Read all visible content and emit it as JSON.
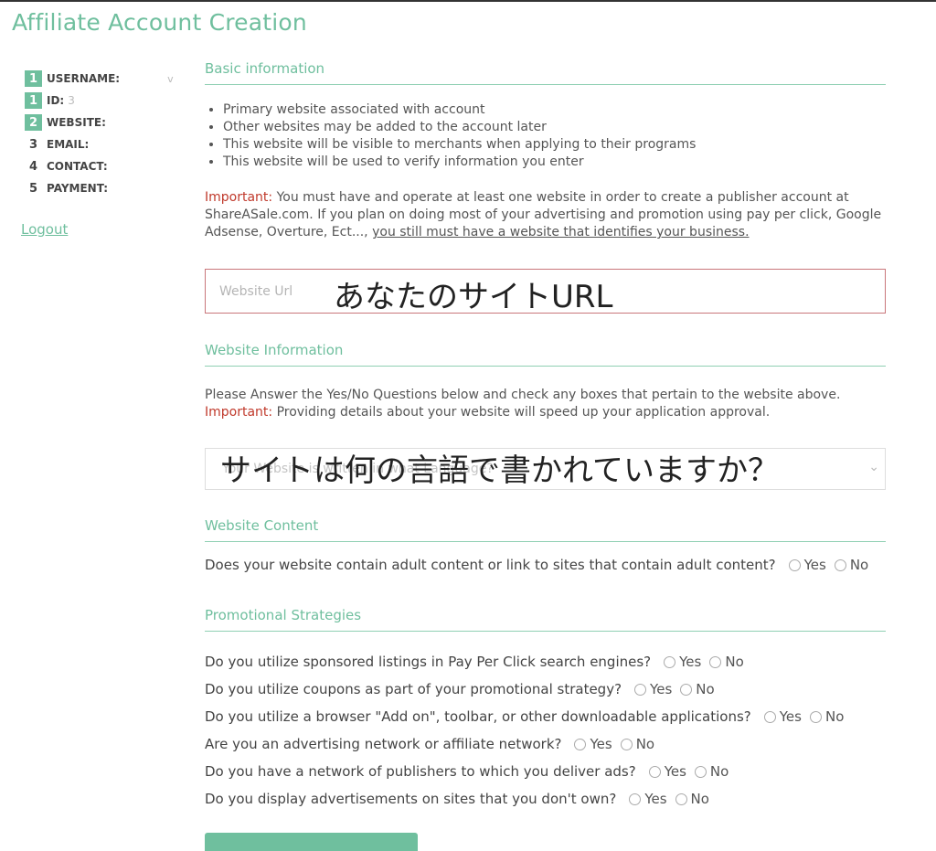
{
  "page": {
    "title": "Affiliate Account Creation"
  },
  "sidebar": {
    "steps": [
      {
        "num": "1",
        "label": "USERNAME:",
        "value": "v"
      },
      {
        "num": "1",
        "label": "ID:",
        "value": "3"
      },
      {
        "num": "2",
        "label": "WEBSITE:",
        "value": ""
      },
      {
        "num": "3",
        "label": "EMAIL:",
        "value": ""
      },
      {
        "num": "4",
        "label": "CONTACT:",
        "value": ""
      },
      {
        "num": "5",
        "label": "PAYMENT:",
        "value": ""
      }
    ],
    "logout_label": "Logout"
  },
  "basic": {
    "heading": "Basic information",
    "bullets": [
      "Primary website associated with account",
      "Other websites may be added to the account later",
      "This website will be visible to merchants when applying to their programs",
      "This website will be used to verify information you enter"
    ],
    "important_label": "Important:",
    "important_text": " You must have and operate at least one website in order to create a publisher account at ShareASale.com. If you plan on doing most of your advertising and promotion using pay per click, Google Adsense, Overture, Ect..., ",
    "important_underlined": "you still must have a website that identifies your business."
  },
  "url_field": {
    "placeholder": "Website Url",
    "overlay_text": "あなたのサイトURL"
  },
  "website_info": {
    "heading": "Website Information",
    "line1": "Please Answer the Yes/No Questions below and check any boxes that pertain to the website above.",
    "important_label": "Important:",
    "important_text": " Providing details about your website will speed up your application approval.",
    "select_placeholder": "Your Website is written in what Language?",
    "overlay_text": "サイトは何の言語で書かれていますか？"
  },
  "website_content": {
    "heading": "Website Content",
    "question": "Does your website contain adult content or link to sites that contain adult content?",
    "yes": "Yes",
    "no": "No"
  },
  "promo": {
    "heading": "Promotional Strategies",
    "questions": [
      "Do you utilize sponsored listings in Pay Per Click search engines?",
      "Do you utilize coupons as part of your promotional strategy?",
      "Do you utilize a browser \"Add on\", toolbar, or other downloadable applications?",
      "Are you an advertising network or affiliate network?",
      "Do you have a network of publishers to which you deliver ads?",
      "Do you display advertisements on sites that you don't own?"
    ],
    "yes": "Yes",
    "no": "No"
  },
  "colors": {
    "accent": "#6fbf9e",
    "important": "#c0392b",
    "error_border": "#c9767a"
  }
}
